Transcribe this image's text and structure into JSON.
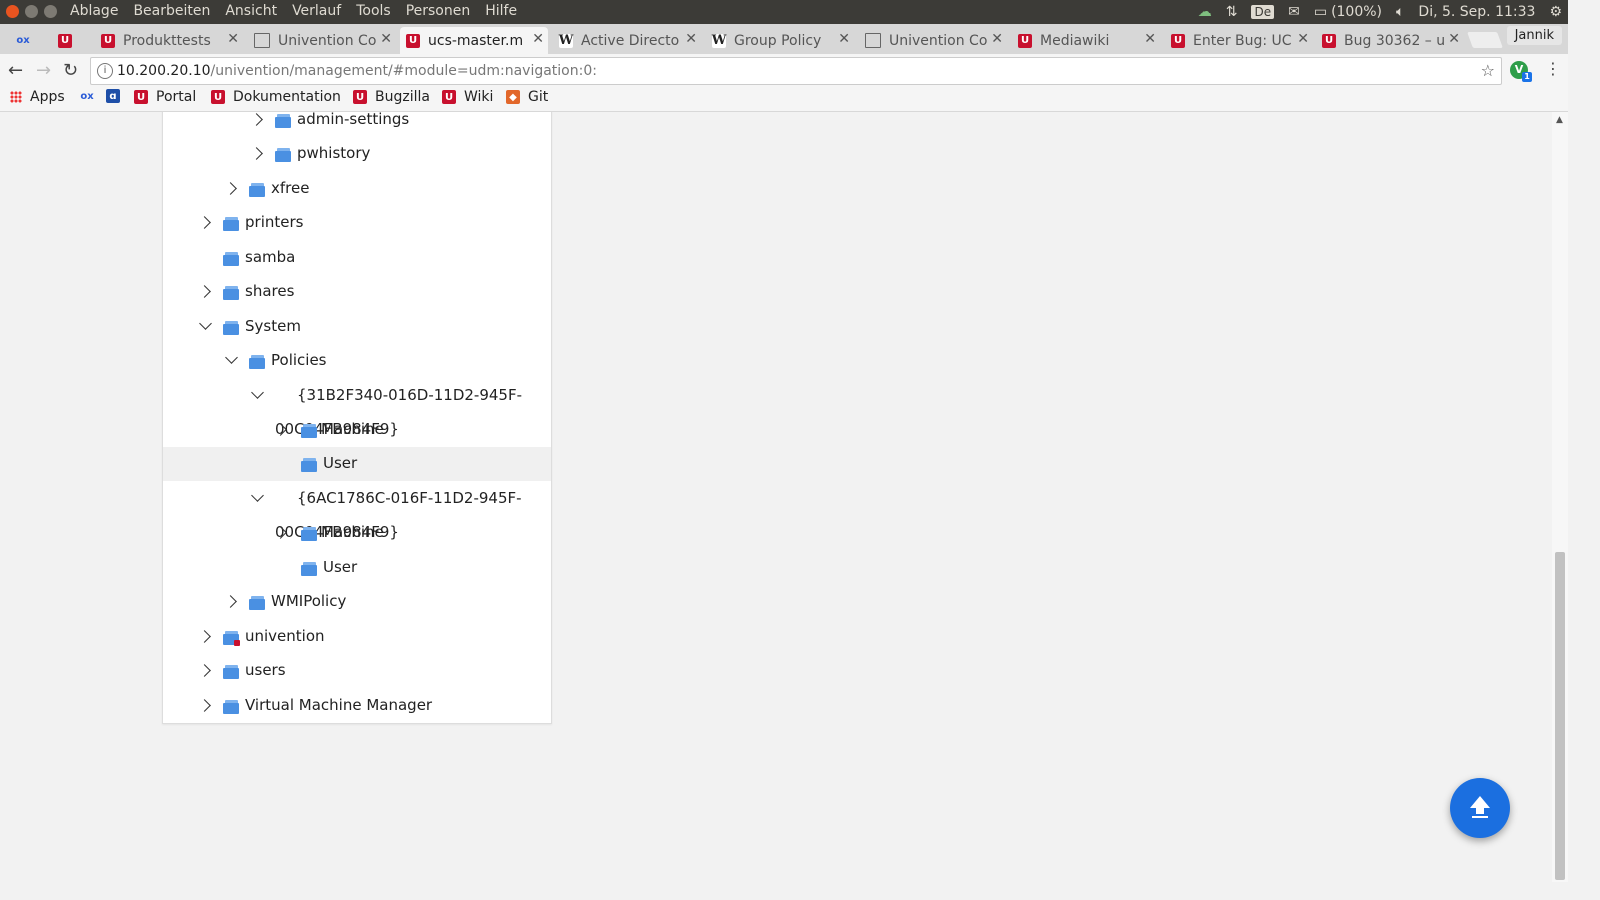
{
  "os_menu": [
    "Ablage",
    "Bearbeiten",
    "Ansicht",
    "Verlauf",
    "Tools",
    "Personen",
    "Hilfe"
  ],
  "tray": {
    "keyboard": "De",
    "battery": "(100%)",
    "clock": "Di, 5. Sep. 11:33"
  },
  "tabs": [
    {
      "title": "",
      "fav": "ox"
    },
    {
      "title": "",
      "fav": "u"
    },
    {
      "title": "Produkttests",
      "fav": "u"
    },
    {
      "title": "Univention Co",
      "fav": "doc"
    },
    {
      "title": "ucs-master.m",
      "fav": "u",
      "active": true
    },
    {
      "title": "Active Directo",
      "fav": "w"
    },
    {
      "title": "Group Policy",
      "fav": "w"
    },
    {
      "title": "Univention Co",
      "fav": "doc"
    },
    {
      "title": "Mediawiki",
      "fav": "u"
    },
    {
      "title": "Enter Bug: UC",
      "fav": "u"
    },
    {
      "title": "Bug 30362 – u",
      "fav": "u"
    }
  ],
  "profile_name": "Jannik",
  "address": {
    "host": "10.200.20.10",
    "path": "/univention/management/#module=udm:navigation:0:"
  },
  "bookmarks": [
    "Apps",
    "Portal",
    "Dokumentation",
    "Bugzilla",
    "Wiki",
    "Git"
  ],
  "tree": [
    {
      "label": "admin-settings",
      "chevron": "right"
    },
    {
      "label": "pwhistory",
      "chevron": "right"
    },
    {
      "label": "xfree",
      "chevron": "right"
    },
    {
      "label": "printers",
      "chevron": "right"
    },
    {
      "label": "samba",
      "chevron": "none"
    },
    {
      "label": "shares",
      "chevron": "right"
    },
    {
      "label": "System",
      "chevron": "down"
    },
    {
      "label": "Policies",
      "chevron": "down"
    },
    {
      "label": "{31B2F340-016D-11D2-945F-",
      "chevron": "down",
      "overlap_text": "00C04FB984F9}",
      "overlap_child": "Machine"
    },
    {
      "label": "User",
      "chevron": "none",
      "selected": true
    },
    {
      "label": "{6AC1786C-016F-11D2-945F-",
      "chevron": "down",
      "overlap_text": "00C04FB984F9}",
      "overlap_child": "Machine"
    },
    {
      "label": "User",
      "chevron": "none"
    },
    {
      "label": "WMIPolicy",
      "chevron": "right"
    },
    {
      "label": "univention",
      "chevron": "right"
    },
    {
      "label": "users",
      "chevron": "right"
    },
    {
      "label": "Virtual Machine Manager",
      "chevron": "right"
    }
  ]
}
